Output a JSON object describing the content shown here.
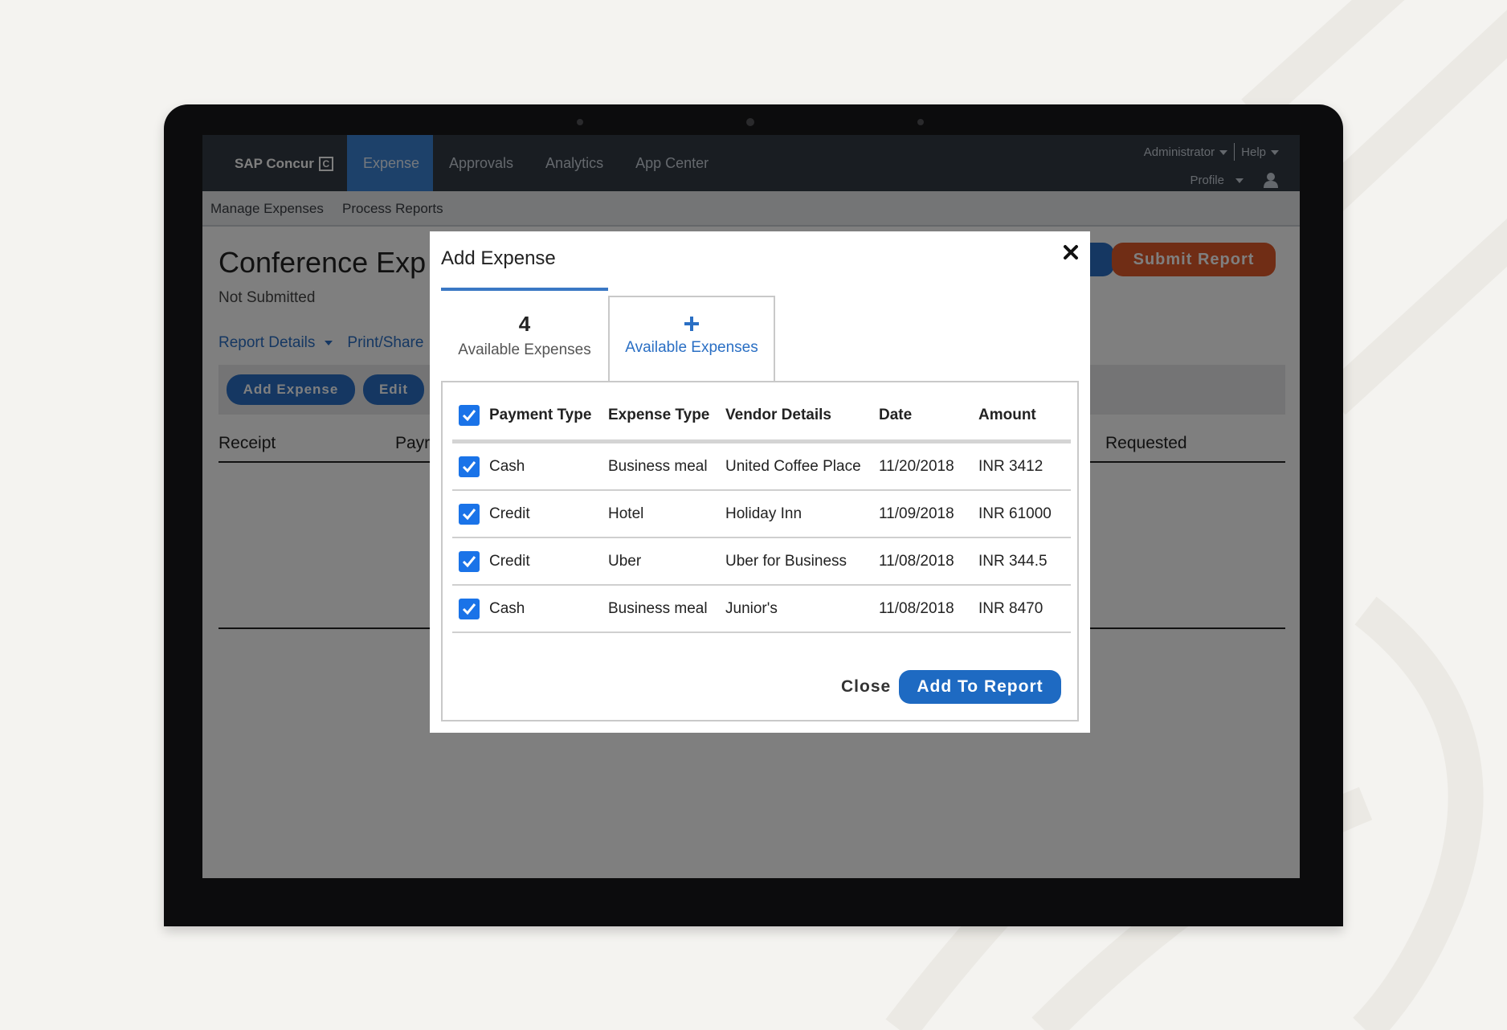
{
  "app": {
    "brand": "SAP Concur",
    "brand_mark": "C",
    "nav": [
      "Expense",
      "Approvals",
      "Analytics",
      "App Center"
    ],
    "util": {
      "administrator": "Administrator",
      "help": "Help",
      "profile": "Profile"
    },
    "subnav": [
      "Manage Expenses",
      "Process Reports"
    ]
  },
  "report": {
    "title": "Conference Exp",
    "status": "Not Submitted",
    "links": {
      "details": "Report Details",
      "print": "Print/Share"
    },
    "buttons": {
      "add_expense": "Add Expense",
      "edit": "Edit",
      "submit": "Submit Report"
    },
    "columns": {
      "receipt": "Receipt",
      "payment": "Payr",
      "requested": "Requested"
    }
  },
  "modal": {
    "title": "Add Expense",
    "tabs": [
      {
        "count": "4",
        "label": "Available Expenses"
      },
      {
        "label": "Available Expenses"
      }
    ],
    "headers": [
      "Payment Type",
      "Expense Type",
      "Vendor Details",
      "Date",
      "Amount"
    ],
    "rows": [
      {
        "payment": "Cash",
        "expense": "Business meal",
        "vendor": "United Coffee Place",
        "date": "11/20/2018",
        "amount": "INR 3412"
      },
      {
        "payment": "Credit",
        "expense": "Hotel",
        "vendor": "Holiday Inn",
        "date": "11/09/2018",
        "amount": "INR 61000"
      },
      {
        "payment": "Credit",
        "expense": "Uber",
        "vendor": "Uber for Business",
        "date": "11/08/2018",
        "amount": "INR 344.5"
      },
      {
        "payment": "Cash",
        "expense": "Business meal",
        "vendor": "Junior's",
        "date": "11/08/2018",
        "amount": "INR 8470"
      }
    ],
    "close_label": "Close",
    "add_label": "Add To Report"
  },
  "icons": [
    "close-icon",
    "plus-icon",
    "checkbox-icon",
    "caret-down-icon",
    "user-icon"
  ],
  "colors": {
    "accent": "#1a73e8",
    "nav_bg": "#333a44",
    "submit": "#e05a2b",
    "primary_button": "#1e6ac2"
  }
}
